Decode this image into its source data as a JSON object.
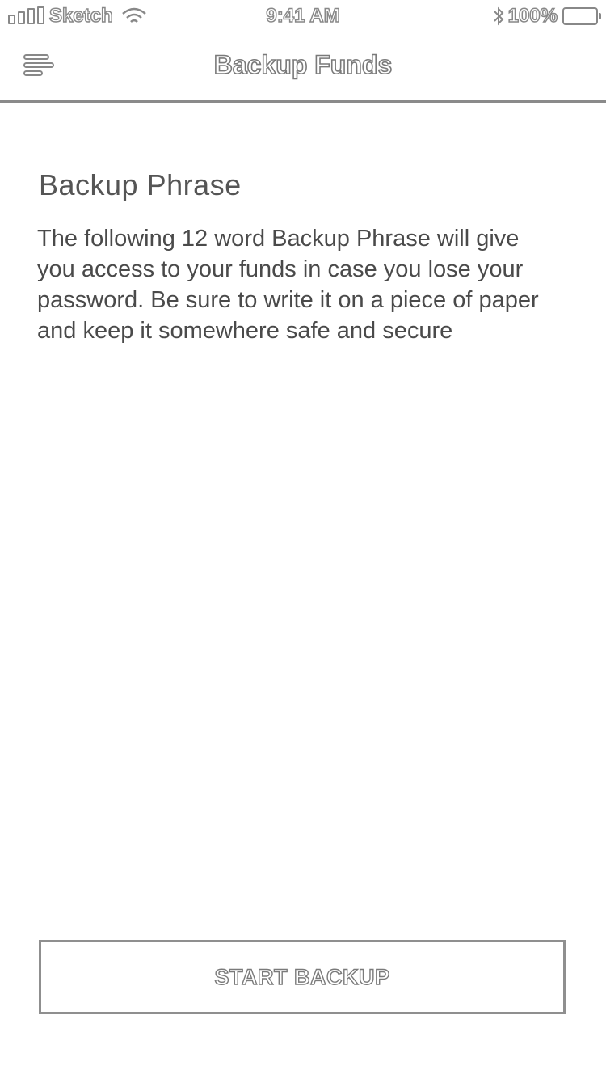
{
  "status_bar": {
    "carrier": "Sketch",
    "time": "9:41 AM",
    "battery": "100%",
    "icons": [
      "signal-icon",
      "wifi-icon",
      "bluetooth-icon",
      "battery-icon"
    ]
  },
  "nav": {
    "title": "Backup Funds",
    "menu_icon": "menu-icon"
  },
  "content": {
    "heading": "Backup Phrase",
    "description": "The following 12 word Backup Phrase will give you access to your funds in case you lose your password. Be sure to write it on a piece of paper and keep it somewhere safe and secure"
  },
  "actions": {
    "start_backup": "START BACKUP"
  },
  "colors": {
    "text": "#4a4a4a",
    "outline": "#8a8a8a",
    "background": "#ffffff"
  }
}
